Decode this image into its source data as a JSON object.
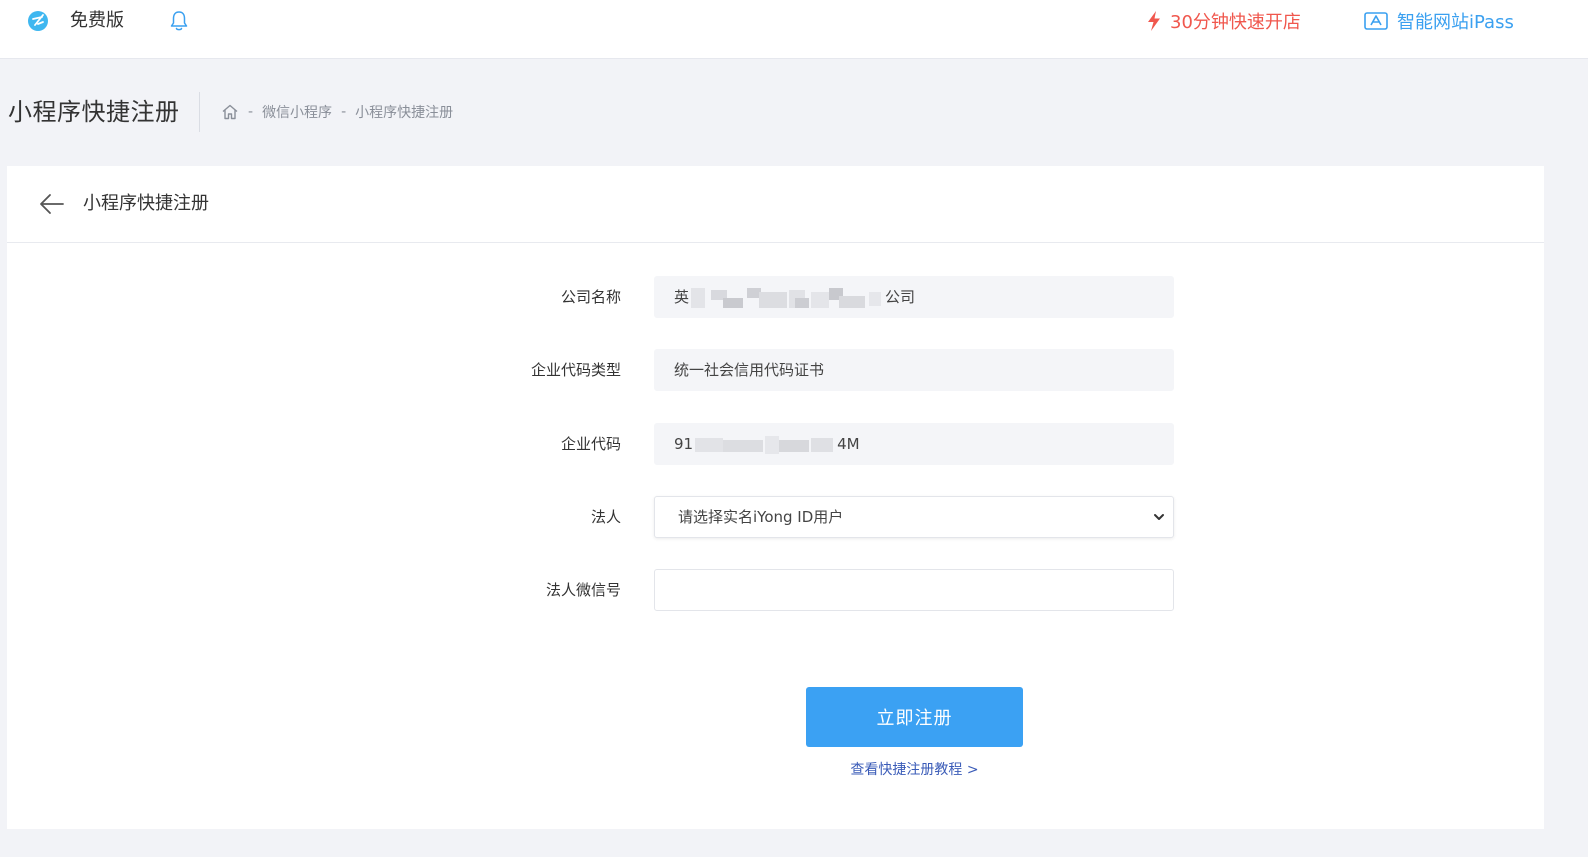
{
  "topbar": {
    "edition_label": "免费版",
    "quick_open_label": "30分钟快速开店",
    "ipass_label": "智能网站iPass",
    "colors": {
      "quick_open": "#f0574d",
      "ipass": "#3aa0f0",
      "logo": "#3fb7f0"
    },
    "icons": [
      "logo-icon",
      "bell-icon",
      "lightning-icon",
      "ipass-icon"
    ]
  },
  "header": {
    "page_title": "小程序快捷注册",
    "breadcrumb": {
      "home_icon": "home-icon",
      "separator": "-",
      "items": [
        "微信小程序",
        "小程序快捷注册"
      ]
    }
  },
  "card": {
    "title": "小程序快捷注册",
    "back_icon": "back-arrow-icon",
    "fields": {
      "company_name": {
        "label": "公司名称",
        "value_prefix": "英",
        "value_suffix": "公司"
      },
      "code_type": {
        "label": "企业代码类型",
        "value": "统一社会信用代码证书"
      },
      "enterprise_code": {
        "label": "企业代码",
        "value_prefix": "91",
        "value_suffix": "4M"
      },
      "legal_person": {
        "label": "法人",
        "selected": "请选择实名iYong ID用户"
      },
      "legal_wechat": {
        "label": "法人微信号",
        "value": ""
      }
    },
    "submit_label": "立即注册",
    "tutorial_link": "查看快捷注册教程 >",
    "colors": {
      "primary": "#3ba1f3",
      "link": "#3b5cb8"
    }
  }
}
